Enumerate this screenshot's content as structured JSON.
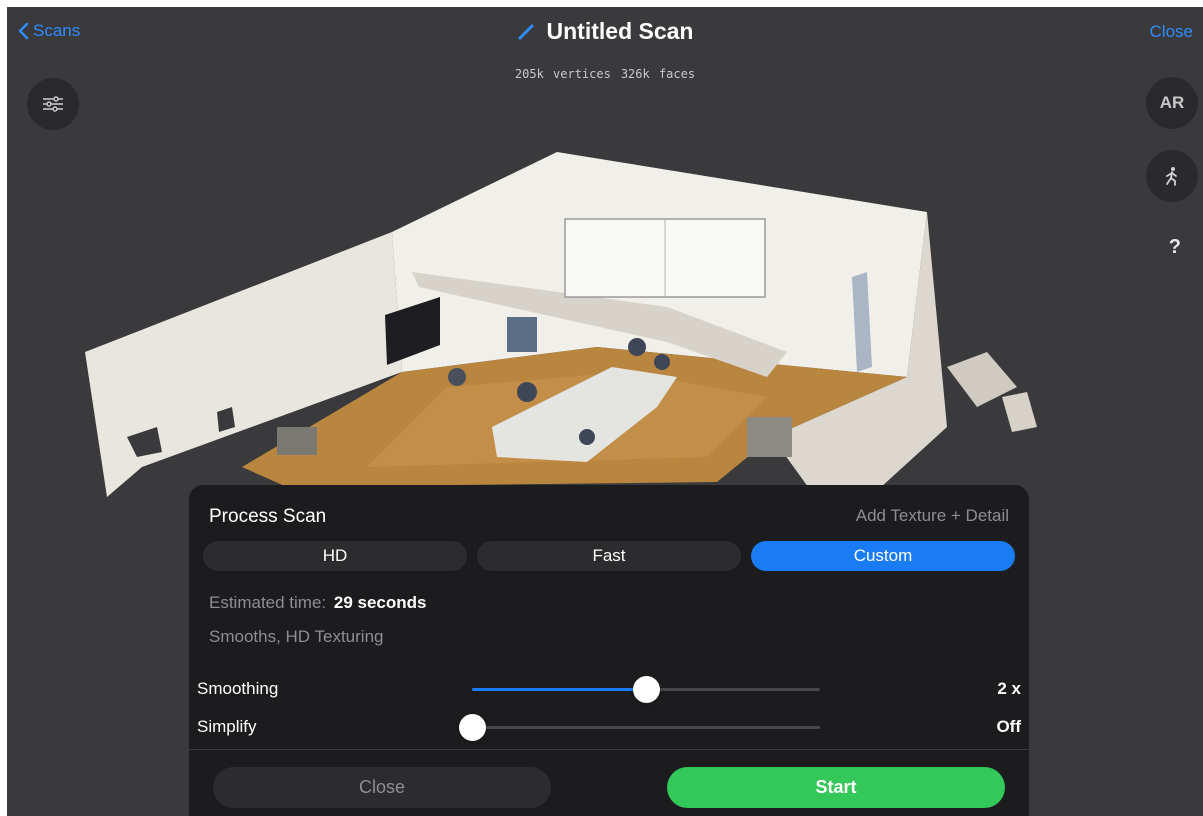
{
  "nav": {
    "back_label": "Scans",
    "title": "Untitled Scan",
    "close_label": "Close",
    "back_icon": "chevron-left-icon",
    "edit_icon": "pencil-icon"
  },
  "stats": {
    "vertices": "205k vertices",
    "faces": "326k faces"
  },
  "side_buttons": {
    "ar_label": "AR",
    "help_label": "?",
    "filter_icon": "sliders-icon",
    "walk_icon": "walking-person-icon"
  },
  "panel": {
    "title": "Process Scan",
    "texture_link": "Add Texture + Detail",
    "modes": [
      "HD",
      "Fast",
      "Custom"
    ],
    "selected_mode": "Custom",
    "estimated_label": "Estimated time:",
    "estimated_value": "29 seconds",
    "description": "Smooths, HD Texturing",
    "smoothing": {
      "label": "Smoothing",
      "value_label": "2 x",
      "level": 0.5
    },
    "simplify": {
      "label": "Simplify",
      "value_label": "Off",
      "level": 0.0
    },
    "close_label": "Close",
    "start_label": "Start"
  },
  "colors": {
    "accent": "#1a7cf5",
    "start": "#34c759",
    "background": "#3a3a3c",
    "panel": "#1c1c1e"
  }
}
